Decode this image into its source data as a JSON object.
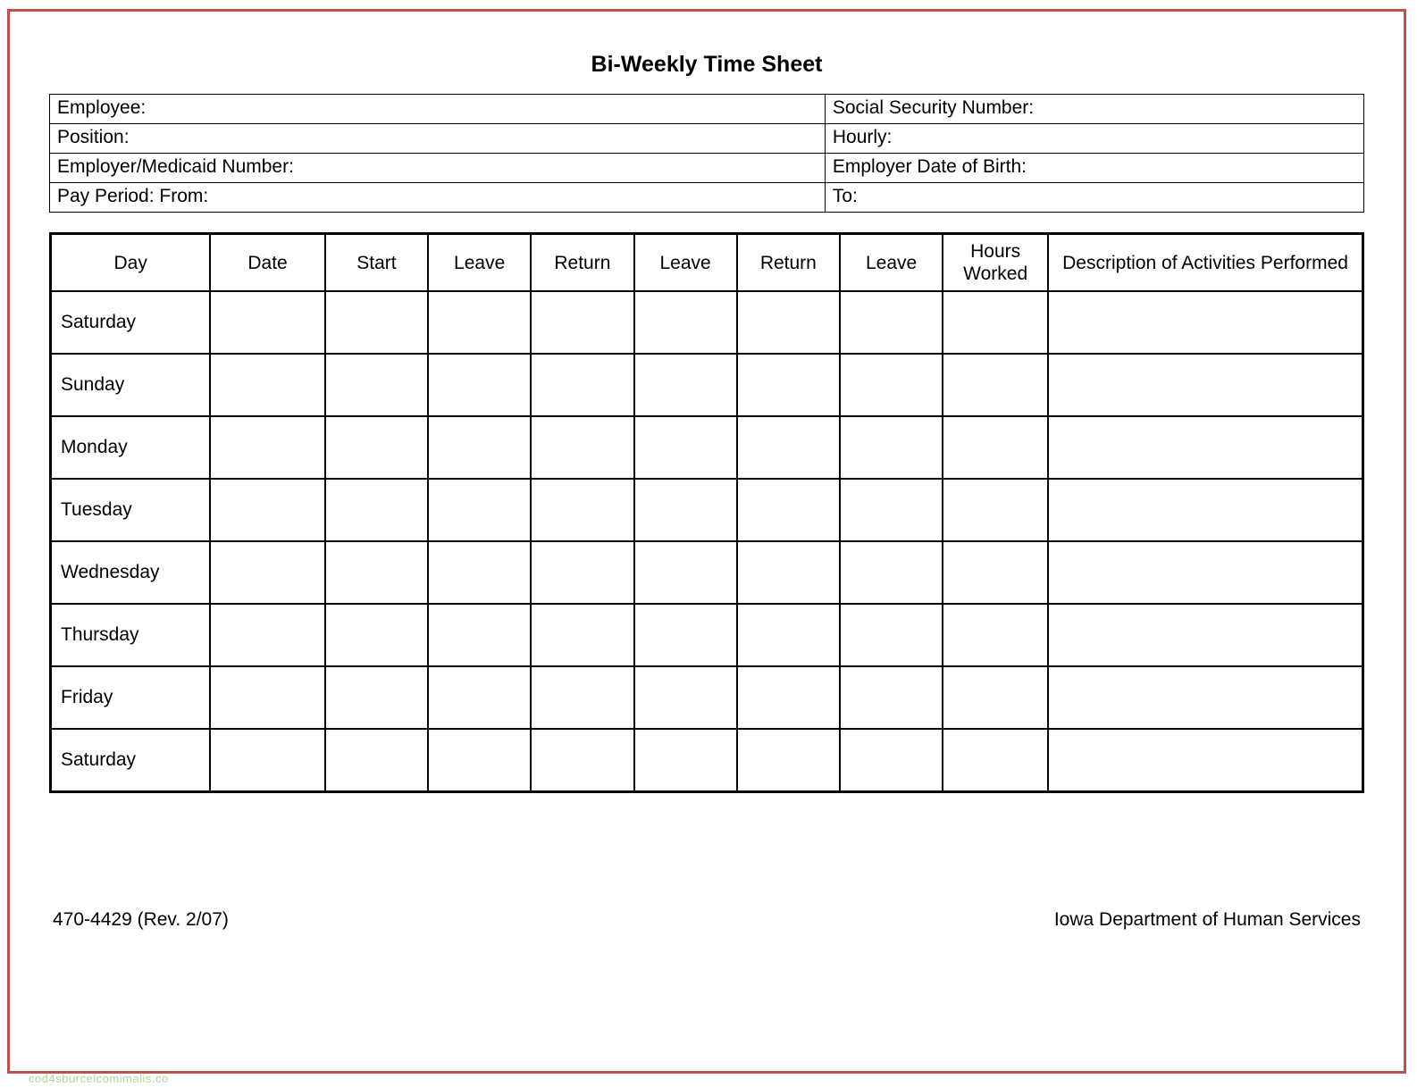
{
  "title": "Bi-Weekly Time Sheet",
  "info": {
    "employee_label": "Employee:",
    "ssn_label": "Social Security Number:",
    "position_label": "Position:",
    "hourly_label": "Hourly:",
    "employer_medicaid_label": "Employer/Medicaid Number:",
    "employer_dob_label": "Employer Date of Birth:",
    "pay_period_from_label": "Pay Period:  From:",
    "to_label": "To:"
  },
  "columns": {
    "day": "Day",
    "date": "Date",
    "start": "Start",
    "leave1": "Leave",
    "return1": "Return",
    "leave2": "Leave",
    "return2": "Return",
    "leave3": "Leave",
    "hours_worked": "Hours Worked",
    "description": "Description of Activities Performed"
  },
  "rows": [
    {
      "day": "Saturday"
    },
    {
      "day": "Sunday"
    },
    {
      "day": "Monday"
    },
    {
      "day": "Tuesday"
    },
    {
      "day": "Wednesday"
    },
    {
      "day": "Thursday"
    },
    {
      "day": "Friday"
    },
    {
      "day": "Saturday"
    }
  ],
  "footer": {
    "form_ref": "470-4429  (Rev. 2/07)",
    "agency": "Iowa Department of Human Services"
  },
  "watermark": "cod4sburcelcomimalis.co"
}
